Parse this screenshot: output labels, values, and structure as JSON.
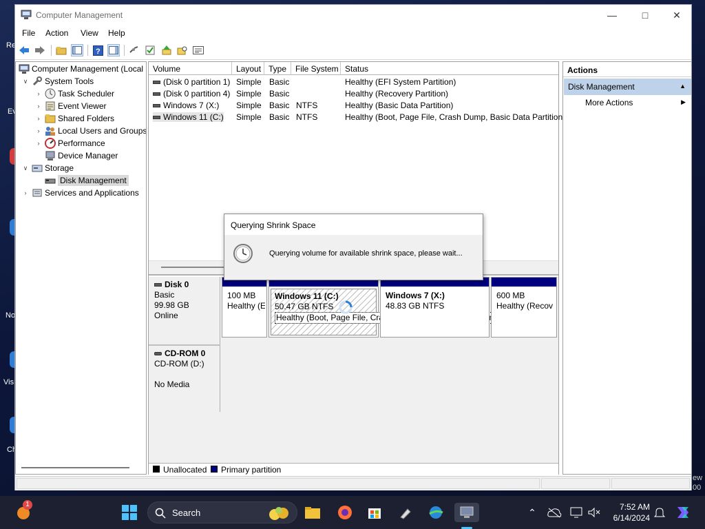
{
  "window": {
    "title": "Computer Management",
    "menu": [
      "File",
      "Action",
      "View",
      "Help"
    ]
  },
  "tree": {
    "root": "Computer Management (Local",
    "items": [
      {
        "label": "System Tools"
      },
      {
        "label": "Task Scheduler"
      },
      {
        "label": "Event Viewer"
      },
      {
        "label": "Shared Folders"
      },
      {
        "label": "Local Users and Groups"
      },
      {
        "label": "Performance"
      },
      {
        "label": "Device Manager"
      },
      {
        "label": "Storage"
      },
      {
        "label": "Disk Management"
      },
      {
        "label": "Services and Applications"
      }
    ]
  },
  "volumes": {
    "columns": [
      "Volume",
      "Layout",
      "Type",
      "File System",
      "Status"
    ],
    "rows": [
      {
        "volume": "(Disk 0 partition 1)",
        "layout": "Simple",
        "type": "Basic",
        "fs": "",
        "status": "Healthy (EFI System Partition)"
      },
      {
        "volume": "(Disk 0 partition 4)",
        "layout": "Simple",
        "type": "Basic",
        "fs": "",
        "status": "Healthy (Recovery Partition)"
      },
      {
        "volume": "Windows 7 (X:)",
        "layout": "Simple",
        "type": "Basic",
        "fs": "NTFS",
        "status": "Healthy (Basic Data Partition)"
      },
      {
        "volume": "Windows 11 (C:)",
        "layout": "Simple",
        "type": "Basic",
        "fs": "NTFS",
        "status": "Healthy (Boot, Page File, Crash Dump, Basic Data Partition)"
      }
    ]
  },
  "disks": {
    "disk0": {
      "name": "Disk 0",
      "type": "Basic",
      "size": "99.98 GB",
      "state": "Online",
      "partitions": [
        {
          "line1": "100 MB",
          "line2": "Healthy (E"
        },
        {
          "name": "Windows 11  (C:)",
          "line1": "50.47 GB NTFS",
          "line2": "Healthy (Boot, Page File, Crash Dump, Basic Data Partition)"
        },
        {
          "name": "Windows 7  (X:)",
          "line1": "48.83 GB NTFS",
          "line2": ""
        },
        {
          "line1": "600 MB",
          "line2": "Healthy (Recov"
        }
      ]
    },
    "cdrom0": {
      "name": "CD-ROM 0",
      "type": "CD-ROM (D:)",
      "state": "No Media"
    }
  },
  "legend": [
    {
      "label": "Unallocated",
      "color": "#000000"
    },
    {
      "label": "Primary partition",
      "color": "#000080"
    }
  ],
  "actions": {
    "header": "Actions",
    "section": "Disk Management",
    "item": "More Actions"
  },
  "dialog": {
    "title": "Querying Shrink Space",
    "message": "Querying volume for available shrink space, please wait..."
  },
  "taskbar": {
    "search_label": "Search",
    "time": "7:52 AM",
    "date": "6/14/2024",
    "notification_badge": "1"
  },
  "colors": {
    "partition_band": "#000080",
    "selection": "#bed3ea"
  }
}
